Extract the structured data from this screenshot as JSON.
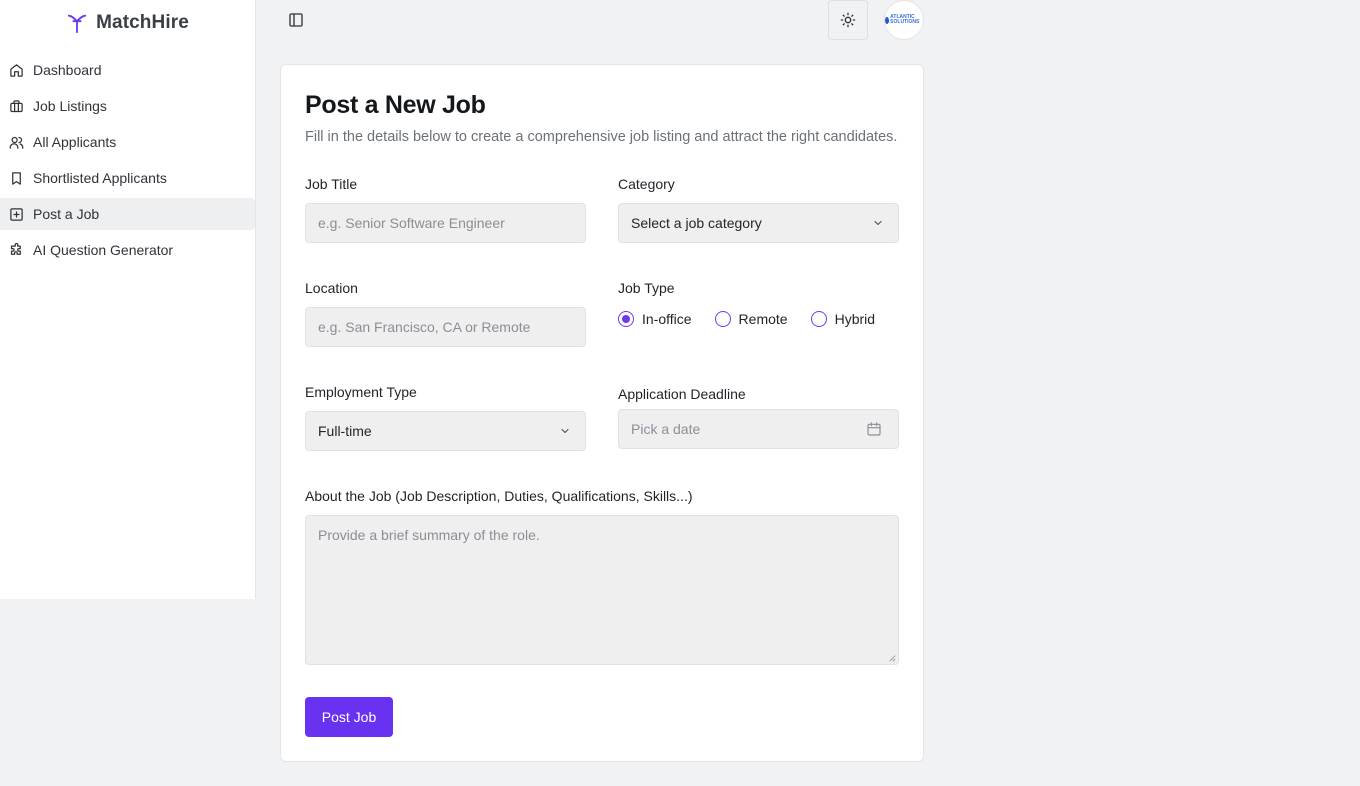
{
  "brand": {
    "name": "MatchHire",
    "accent": "#6b39f0"
  },
  "sidebar": {
    "items": [
      {
        "label": "Dashboard",
        "icon": "home-icon"
      },
      {
        "label": "Job Listings",
        "icon": "briefcase-icon"
      },
      {
        "label": "All Applicants",
        "icon": "users-icon"
      },
      {
        "label": "Shortlisted Applicants",
        "icon": "bookmark-icon"
      },
      {
        "label": "Post a Job",
        "icon": "plus-square-icon",
        "active": true
      },
      {
        "label": "AI Question Generator",
        "icon": "puzzle-icon"
      }
    ]
  },
  "header": {
    "toggle_icon": "sidebar-toggle-icon",
    "theme_icon": "sun-icon",
    "avatar_text": "ATLANTIC SOLUTIONS"
  },
  "form": {
    "title": "Post a New Job",
    "subtitle": "Fill in the details below to create a comprehensive job listing and attract the right candidates.",
    "job_title": {
      "label": "Job Title",
      "placeholder": "e.g. Senior Software Engineer"
    },
    "category": {
      "label": "Category",
      "placeholder": "Select a job category"
    },
    "location": {
      "label": "Location",
      "placeholder": "e.g. San Francisco, CA or Remote"
    },
    "job_type": {
      "label": "Job Type",
      "options": [
        {
          "label": "In-office",
          "checked": true
        },
        {
          "label": "Remote",
          "checked": false
        },
        {
          "label": "Hybrid",
          "checked": false
        }
      ]
    },
    "employment_type": {
      "label": "Employment Type",
      "value": "Full-time"
    },
    "deadline": {
      "label": "Application Deadline",
      "placeholder": "Pick a date"
    },
    "about": {
      "label": "About the Job (Job Description, Duties, Qualifications, Skills...)",
      "placeholder": "Provide a brief summary of the role."
    },
    "submit_label": "Post Job"
  }
}
